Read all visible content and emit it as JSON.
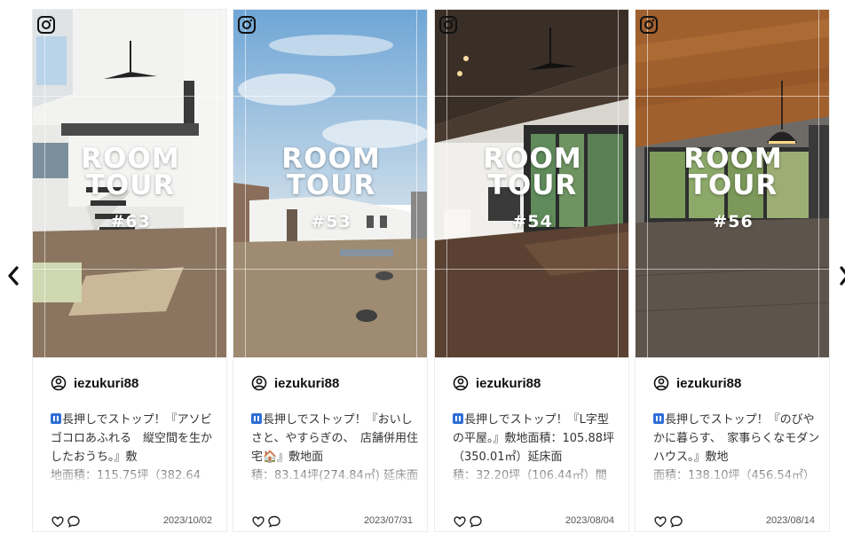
{
  "carousel": {
    "prev_icon": "chevron-left-icon",
    "next_icon": "chevron-right-icon",
    "posts": [
      {
        "overlay_line1": "ROOM",
        "overlay_line2": "TOUR",
        "overlay_number": "#63",
        "author": "iezukuri88",
        "caption_prefix": "長押しでストップ！『アソビゴコロあふれる　縦空間を生かしたおうち。』敷",
        "caption_rest": "地面積：115.75坪（382.64",
        "date": "2023/10/02"
      },
      {
        "overlay_line1": "ROOM",
        "overlay_line2": "TOUR",
        "overlay_number": "#53",
        "author": "iezukuri88",
        "caption_prefix": "長押しでストップ！『おいしさと、やすらぎの、　店舗併用住宅🏠』敷地面",
        "caption_rest": "積：83.14坪(274.84㎡) 延床面",
        "date": "2023/07/31"
      },
      {
        "overlay_line1": "ROOM",
        "overlay_line2": "TOUR",
        "overlay_number": "#54",
        "author": "iezukuri88",
        "caption_prefix": "長押しでストップ！『L字型の平屋。』敷地面積：105.88坪（350.01㎡）延床面",
        "caption_rest": "積：32.20坪（106.44㎡）間",
        "date": "2023/08/04"
      },
      {
        "overlay_line1": "ROOM",
        "overlay_line2": "TOUR",
        "overlay_number": "#56",
        "author": "iezukuri88",
        "caption_prefix": "長押しでストップ！『のびやかに暮らす、　家事らくなモダンハウス。』敷地",
        "caption_rest": "面積：138.10坪（456.54㎡）",
        "date": "2023/08/14"
      }
    ]
  },
  "colors": {
    "badge": "#2f6fd6",
    "overlay_text": "#ffffff",
    "date_text": "#555555"
  }
}
